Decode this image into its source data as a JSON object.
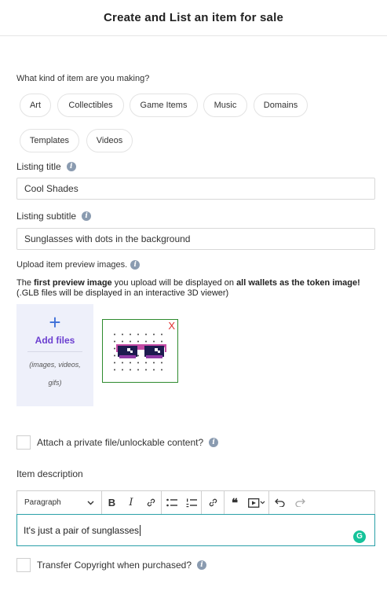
{
  "header": {
    "title": "Create and List an item for sale"
  },
  "item_type": {
    "question": "What kind of item are you making?",
    "options": [
      "Art",
      "Collectibles",
      "Game Items",
      "Music",
      "Domains",
      "Templates",
      "Videos"
    ]
  },
  "listing_title": {
    "label": "Listing title",
    "value": "Cool Shades",
    "info_icon": "i"
  },
  "listing_subtitle": {
    "label": "Listing subtitle",
    "value": "Sunglasses with dots in the background",
    "info_icon": "i"
  },
  "upload": {
    "label": "Upload item preview images.",
    "info_icon": "i",
    "note_part1": "The ",
    "note_bold1": "first preview image",
    "note_part2": " you upload will be displayed on ",
    "note_bold2": "all wallets as the token image!",
    "note_line2": "(.GLB files will be displayed in an interactive 3D viewer)",
    "add_plus": "+",
    "add_label": "Add files",
    "add_hint": "(images, videos, gifs)",
    "remove_label": "X"
  },
  "private_file": {
    "label": "Attach a private file/unlockable content?",
    "info_icon": "i"
  },
  "description": {
    "label": "Item description",
    "format_select": "Paragraph",
    "toolbar": {
      "bold": "B",
      "italic": "I",
      "quote": "❝"
    },
    "value": "It's just a pair of sunglasses",
    "grammarly": "G"
  },
  "copyright": {
    "label": "Transfer Copyright when purchased?",
    "info_icon": "i"
  },
  "colors": {
    "accent_blue": "#3d6fd8",
    "accent_purple": "#6b3fd0",
    "thumb_border": "#2e8b2e",
    "editor_focus": "#2aa0a8"
  }
}
